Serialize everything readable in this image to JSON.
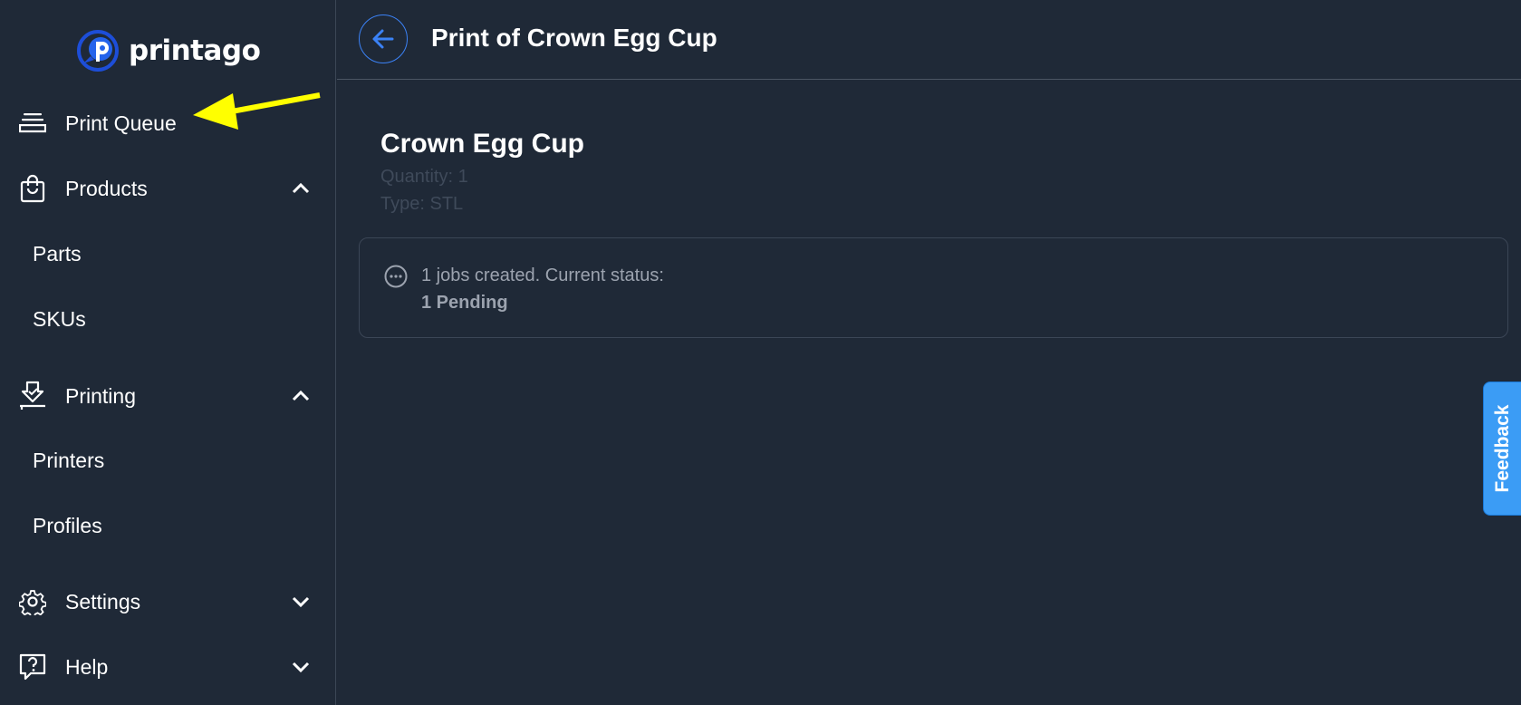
{
  "app": {
    "name": "printago"
  },
  "sidebar": {
    "print_queue": {
      "label": "Print Queue",
      "icon": "queue-icon"
    },
    "products": {
      "label": "Products",
      "icon": "shopping-bag-icon",
      "expanded": true,
      "children": [
        {
          "label": "Parts"
        },
        {
          "label": "SKUs"
        }
      ]
    },
    "printing": {
      "label": "Printing",
      "icon": "printer-icon",
      "expanded": true,
      "children": [
        {
          "label": "Printers"
        },
        {
          "label": "Profiles"
        }
      ]
    },
    "settings": {
      "label": "Settings",
      "icon": "gear-icon",
      "expanded": false
    },
    "help": {
      "label": "Help",
      "icon": "help-icon",
      "expanded": false
    }
  },
  "header": {
    "title": "Print of Crown Egg Cup",
    "back_icon": "arrow-left-icon"
  },
  "part": {
    "name": "Crown Egg Cup",
    "quantity": "Quantity: 1",
    "type": "Type: STL"
  },
  "status": {
    "icon": "ellipsis-circle-icon",
    "summary": "1 jobs created. Current status:",
    "detail": "1 Pending"
  },
  "feedback": {
    "label": "Feedback"
  },
  "colors": {
    "background": "#1f2937",
    "accent": "#3b82f6",
    "feedback": "#3b9cf5",
    "annotation_arrow": "#ffff00"
  }
}
